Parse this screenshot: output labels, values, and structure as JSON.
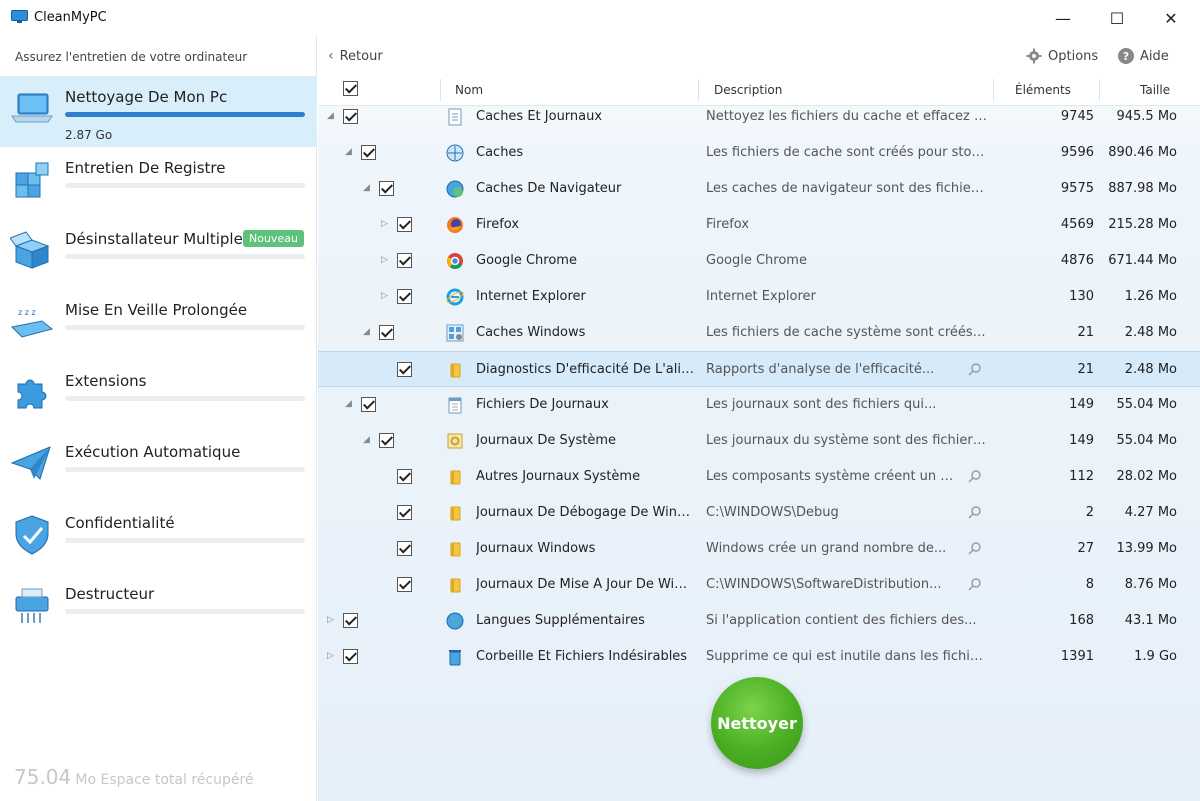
{
  "window": {
    "title": "CleanMyPC",
    "minimize_glyph": "—",
    "maximize_glyph": "☐",
    "close_glyph": "✕"
  },
  "sidebar": {
    "subtitle": "Assurez l'entretien de votre ordinateur",
    "items": [
      {
        "label": "Nettoyage De Mon Pc",
        "size": "2.87 Go",
        "active": true,
        "icon": "laptop-icon",
        "progress": 1.0
      },
      {
        "label": "Entretien De Registre",
        "icon": "registry-cubes-icon",
        "progress": 0
      },
      {
        "label": "Désinstallateur Multiple",
        "badge": "Nouveau",
        "icon": "box-icon",
        "progress": 0
      },
      {
        "label": "Mise En Veille Prolongée",
        "icon": "sleep-laptop-icon",
        "progress": 0
      },
      {
        "label": "Extensions",
        "icon": "puzzle-icon",
        "progress": 0
      },
      {
        "label": "Exécution Automatique",
        "icon": "paper-plane-icon",
        "progress": 0
      },
      {
        "label": "Confidentialité",
        "icon": "shield-icon",
        "progress": 0
      },
      {
        "label": "Destructeur",
        "icon": "shredder-icon",
        "progress": 0
      }
    ],
    "footer_value": "75.04",
    "footer_text": "Mo Espace total récupéré"
  },
  "toolbar": {
    "back_label": "Retour",
    "options_label": "Options",
    "help_label": "Aide"
  },
  "table": {
    "headers": {
      "name": "Nom",
      "description": "Description",
      "elements": "Éléments",
      "size": "Taille"
    },
    "rows": [
      {
        "name": "Caches Et Journaux",
        "description": "Nettoyez les fichiers du cache et effacez les...",
        "elements": "9745",
        "size": "945.5 Mo",
        "level": 0,
        "expander": "open",
        "icon": "document-icon"
      },
      {
        "name": "Caches",
        "description": "Les fichiers de cache sont créés pour stocker...",
        "elements": "9596",
        "size": "890.46 Mo",
        "level": 1,
        "expander": "open",
        "icon": "cache-gear-icon"
      },
      {
        "name": "Caches De Navigateur",
        "description": "Les caches de navigateur sont des fichiers...",
        "elements": "9575",
        "size": "887.98 Mo",
        "level": 2,
        "expander": "open",
        "icon": "browser-globe-icon"
      },
      {
        "name": "Firefox",
        "description": "Firefox",
        "elements": "4569",
        "size": "215.28 Mo",
        "level": 3,
        "expander": "closed",
        "icon": "firefox-icon"
      },
      {
        "name": "Google Chrome",
        "description": "Google Chrome",
        "elements": "4876",
        "size": "671.44 Mo",
        "level": 3,
        "expander": "closed",
        "icon": "chrome-icon"
      },
      {
        "name": "Internet Explorer",
        "description": "Internet Explorer",
        "elements": "130",
        "size": "1.26 Mo",
        "level": 3,
        "expander": "closed",
        "icon": "ie-icon"
      },
      {
        "name": "Caches Windows",
        "description": "Les fichiers de cache système sont créés pour...",
        "elements": "21",
        "size": "2.48 Mo",
        "level": 2,
        "expander": "open",
        "icon": "windows-cache-icon"
      },
      {
        "name": "Diagnostics D'efficacité De L'alime...",
        "description": "Rapports d'analyse de l'efficacité...",
        "elements": "21",
        "size": "2.48 Mo",
        "level": 3,
        "expander": "none",
        "icon": "folder-icon",
        "magnifier": true,
        "selected": true
      },
      {
        "name": "Fichiers De Journaux",
        "description": "Les journaux sont des fichiers qui...",
        "elements": "149",
        "size": "55.04 Mo",
        "level": 1,
        "expander": "open",
        "icon": "log-notepad-icon"
      },
      {
        "name": "Journaux De Système",
        "description": "Les journaux du système sont des fichiers...",
        "elements": "149",
        "size": "55.04 Mo",
        "level": 2,
        "expander": "open",
        "icon": "system-log-icon"
      },
      {
        "name": "Autres Journaux Système",
        "description": "Les composants système créent un grand...",
        "elements": "112",
        "size": "28.02 Mo",
        "level": 3,
        "expander": "none",
        "icon": "folder-icon",
        "magnifier": true
      },
      {
        "name": "Journaux De Débogage De Windo...",
        "description": "C:\\WINDOWS\\Debug",
        "elements": "2",
        "size": "4.27 Mo",
        "level": 3,
        "expander": "none",
        "icon": "folder-icon",
        "magnifier": true
      },
      {
        "name": "Journaux Windows",
        "description": "Windows crée un grand nombre de...",
        "elements": "27",
        "size": "13.99 Mo",
        "level": 3,
        "expander": "none",
        "icon": "folder-icon",
        "magnifier": true
      },
      {
        "name": "Journaux De Mise À Jour De Wind...",
        "description": "C:\\WINDOWS\\SoftwareDistribution...",
        "elements": "8",
        "size": "8.76 Mo",
        "level": 3,
        "expander": "none",
        "icon": "folder-icon",
        "magnifier": true
      },
      {
        "name": "Langues Supplémentaires",
        "description": "Si l'application contient des fichiers des...",
        "elements": "168",
        "size": "43.1 Mo",
        "level": 0,
        "expander": "closed",
        "icon": "globe-icon"
      },
      {
        "name": "Corbeille Et Fichiers Indésirables",
        "description": "Supprime ce qui est inutile dans les fichiers...",
        "elements": "1391",
        "size": "1.9 Go",
        "level": 0,
        "expander": "closed",
        "icon": "trash-icon"
      }
    ]
  },
  "clean_button": {
    "label": "Nettoyer"
  },
  "colors": {
    "accent": "#2f7fcf",
    "active_bg": "#d9eefb",
    "badge": "#5cc27c",
    "clean_green": "#4aae23"
  }
}
